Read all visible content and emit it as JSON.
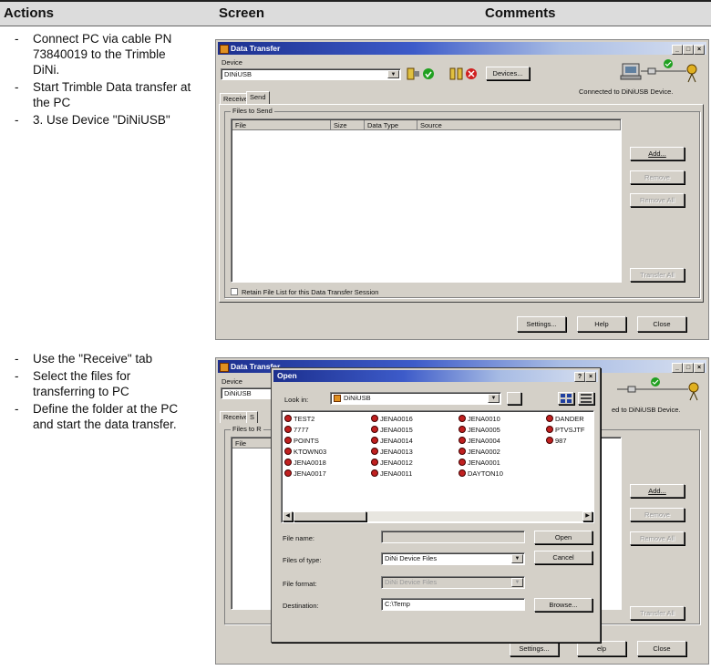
{
  "header": {
    "actions": "Actions",
    "screen": "Screen",
    "comments": "Comments"
  },
  "actions1": [
    "Connect PC via cable PN 73840019 to the Trimble DiNi.",
    "Start Trimble Data transfer at the PC",
    "3. Use Device \"DiNiUSB\""
  ],
  "actions2": [
    "Use the \"Receive\" tab",
    "Select the files for transferring to PC",
    "Define the folder at the PC and start the data transfer."
  ],
  "win1": {
    "title": "Data Transfer",
    "device_group": "Device",
    "device_value": "DINiUSB",
    "devices_btn": "Devices...",
    "connected_text": "Connected to DiNiUSB Device.",
    "tabs": [
      "Receive",
      "Send"
    ],
    "files_group": "Files to Send",
    "columns": [
      "File",
      "Size",
      "Data Type",
      "Source"
    ],
    "add_btn": "Add...",
    "remove_btn": "Remove",
    "remove_all_btn": "Remove All",
    "transfer_all_btn": "Transfer All",
    "retain_label": "Retain File List for this Data Transfer Session",
    "settings_btn": "Settings...",
    "help_btn": "Help",
    "close_btn": "Close"
  },
  "win2": {
    "title": "Data Transfer",
    "device_group": "Device",
    "device_value": "DiNiUSB",
    "tabs_partial": [
      "Receive",
      "S"
    ],
    "files_group_partial": "Files to R",
    "col_file": "File",
    "connected_partial": "ed to DiNiUSB Device.",
    "add_btn": "Add...",
    "remove_btn": "Remove",
    "remove_all_btn": "Remove All",
    "transfer_all_btn": "Transfer All",
    "settings_btn": "Settings...",
    "help_partial": "elp",
    "close_btn": "Close"
  },
  "open_dialog": {
    "title": "Open",
    "look_in_label": "Look in:",
    "look_in_value": "DiNiUSB",
    "files_col1": [
      "TEST2",
      "7777",
      "POINTS",
      "KTOWN03",
      "JENA0018",
      "JENA0017"
    ],
    "files_col2": [
      "JENA0016",
      "JENA0015",
      "JENA0014",
      "JENA0013",
      "JENA0012",
      "JENA0011"
    ],
    "files_col3": [
      "JENA0010",
      "JENA0005",
      "JENA0004",
      "JENA0002",
      "JENA0001",
      "DAYTON10"
    ],
    "files_col4": [
      "DANDER",
      "PTVSJTF",
      "987"
    ],
    "file_name_label": "File name:",
    "files_of_type_label": "Files of type:",
    "files_of_type_value": "DiNi Device Files",
    "file_format_label": "File format:",
    "file_format_value": "DiNi Device Files",
    "destination_label": "Destination:",
    "destination_value": "C:\\Temp",
    "open_btn": "Open",
    "cancel_btn": "Cancel",
    "browse_btn": "Browse..."
  }
}
